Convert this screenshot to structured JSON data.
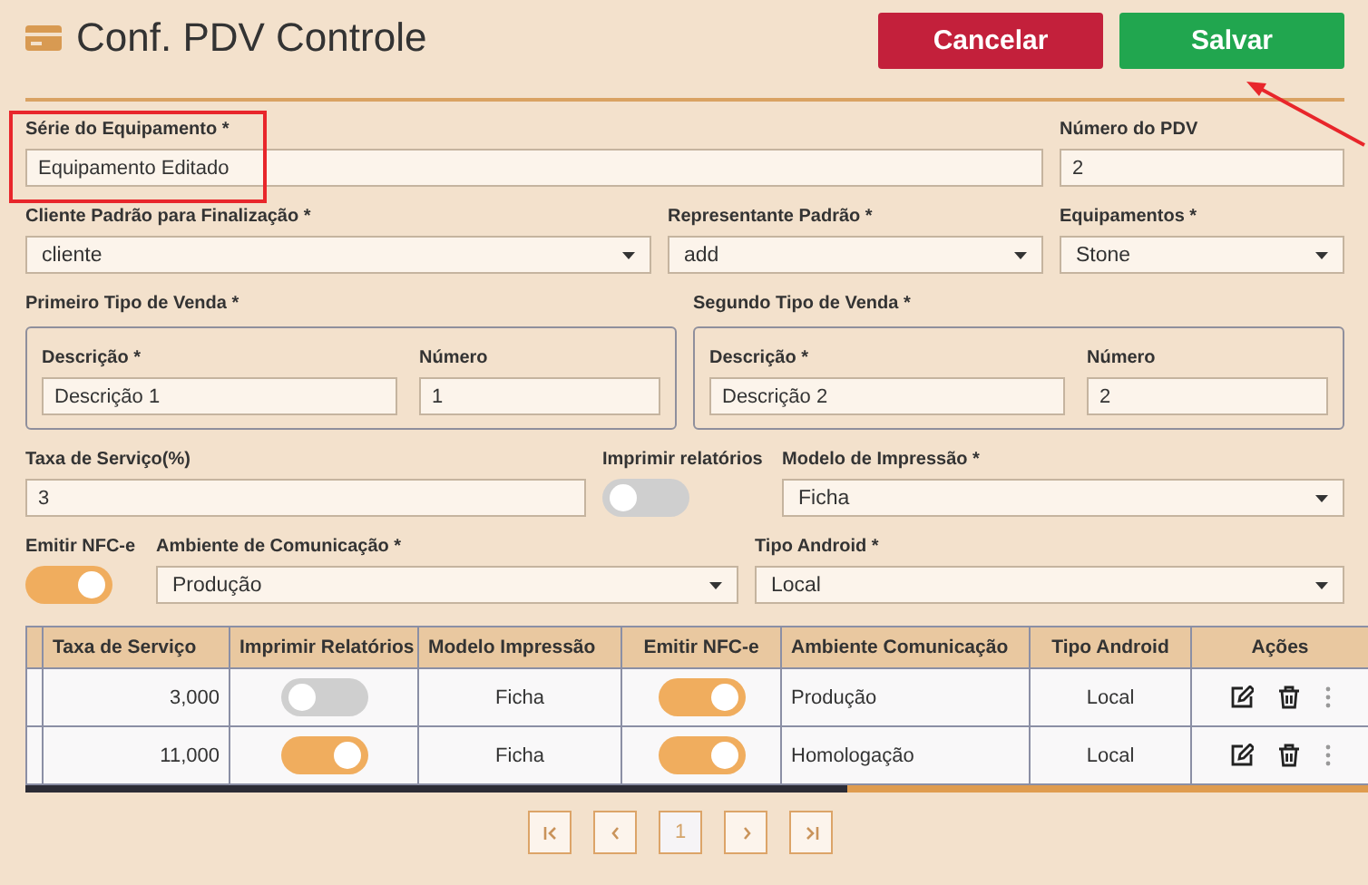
{
  "header": {
    "title": "Conf. PDV Controle",
    "buttons": [
      {
        "label": "Cancelar",
        "kind": "danger",
        "pointed": false
      },
      {
        "label": "Salvar",
        "kind": "primary",
        "pointed": true
      }
    ]
  },
  "form": {
    "rows": [
      {
        "fields": [
          {
            "kind": "text",
            "label": "Série do Equipamento *",
            "value": "Equipamento Editado",
            "highlighted": true
          },
          {
            "kind": "text",
            "label": "Número do PDV",
            "value": "2",
            "highlighted": false
          }
        ]
      },
      {
        "fields": [
          {
            "kind": "select",
            "label": "Cliente Padrão para Finalização *",
            "value": "cliente"
          },
          {
            "kind": "select",
            "label": "Representante Padrão *",
            "value": "add"
          },
          {
            "kind": "select",
            "label": "Equipamentos *",
            "value": "Stone"
          }
        ]
      },
      {
        "fields": [
          {
            "kind": "group",
            "label": "Primeiro Tipo de Venda *",
            "fields": [
              {
                "kind": "text",
                "label": "Descrição *",
                "value": "Descrição 1",
                "highlighted": false
              },
              {
                "kind": "text",
                "label": "Número",
                "value": "1",
                "highlighted": false
              }
            ]
          },
          {
            "kind": "group",
            "label": "Segundo Tipo de Venda *",
            "fields": [
              {
                "kind": "text",
                "label": "Descrição *",
                "value": "Descrição 2",
                "highlighted": false
              },
              {
                "kind": "text",
                "label": "Número",
                "value": "2",
                "highlighted": false
              }
            ]
          }
        ]
      },
      {
        "fields": [
          {
            "kind": "text",
            "label": "Taxa de Serviço(%)",
            "value": "3",
            "highlighted": false
          },
          {
            "kind": "toggle",
            "label": "Imprimir relatórios",
            "on": false
          },
          {
            "kind": "select",
            "label": "Modelo de Impressão *",
            "value": "Ficha"
          }
        ]
      },
      {
        "fields": [
          {
            "kind": "toggle",
            "label": "Emitir NFC-e",
            "on": true
          },
          {
            "kind": "select",
            "label": "Ambiente de Comunicação *",
            "value": "Produção"
          },
          {
            "kind": "select",
            "label": "Tipo Android *",
            "value": "Local"
          }
        ]
      }
    ]
  },
  "table": {
    "columns": [
      "Taxa de Serviço",
      "Imprimir Relatórios",
      "Modelo Impressão",
      "Emitir NFC-e",
      "Ambiente Comunicação",
      "Tipo Android",
      "Ações"
    ],
    "rows": [
      {
        "cells": [
          {
            "kind": "number",
            "text": "3,000"
          },
          {
            "kind": "toggle",
            "on": false
          },
          {
            "kind": "center",
            "text": "Ficha"
          },
          {
            "kind": "toggle",
            "on": true
          },
          {
            "kind": "left",
            "text": "Produção"
          },
          {
            "kind": "center",
            "text": "Local"
          },
          {
            "kind": "actions"
          }
        ]
      },
      {
        "cells": [
          {
            "kind": "number",
            "text": "11,000"
          },
          {
            "kind": "toggle",
            "on": true
          },
          {
            "kind": "center",
            "text": "Ficha"
          },
          {
            "kind": "toggle",
            "on": true
          },
          {
            "kind": "left",
            "text": "Homologação"
          },
          {
            "kind": "center",
            "text": "Local"
          },
          {
            "kind": "actions"
          }
        ]
      }
    ]
  },
  "pagination": {
    "pages": [
      {
        "label": "1",
        "selected": true
      }
    ]
  }
}
